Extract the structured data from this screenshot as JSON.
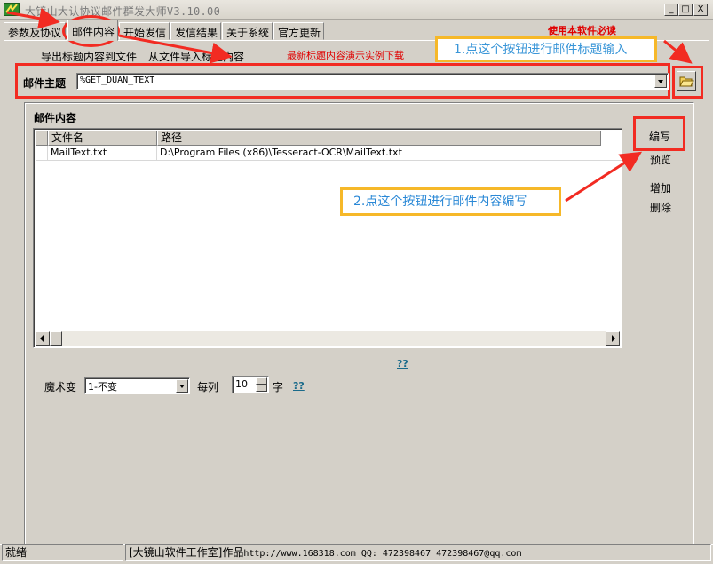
{
  "window": {
    "title": "大镜山大认协议邮件群发大师V3.10.00",
    "minimize": "_",
    "maximize": "□",
    "close": "X"
  },
  "tabs": [
    {
      "label": "参数及协议"
    },
    {
      "label": "邮件内容"
    },
    {
      "label": "开始发信"
    },
    {
      "label": "发信结果"
    },
    {
      "label": "关于系统"
    },
    {
      "label": "官方更新"
    }
  ],
  "toolbar": {
    "export_label": "导出标题内容到文件",
    "import_label": "从文件导入标题内容",
    "must_read": "使用本软件必读",
    "demo_link": "最新标题内容演示实例下载"
  },
  "annotations": {
    "step1": "1.点这个按钮进行邮件标题输入",
    "step2": "2.点这个按钮进行邮件内容编写"
  },
  "subject": {
    "label": "邮件主题",
    "value": "%GET_DUAN_TEXT"
  },
  "content": {
    "title": "邮件内容",
    "columns": [
      "文件名",
      "路径"
    ],
    "rows": [
      {
        "filename": "MailText.txt",
        "path": "D:\\Program Files (x86)\\Tesseract-OCR\\MailText.txt"
      }
    ],
    "buttons": {
      "edit": "编写",
      "preview": "预览",
      "add": "增加",
      "delete": "删除"
    },
    "help_link": "??"
  },
  "options": {
    "magic_label": "魔术变",
    "magic_value": "1-不变",
    "per_column_label": "每列",
    "per_column_value": "10",
    "unit_label": "字",
    "help_link": "??"
  },
  "status": {
    "state": "就绪",
    "credit": "[大镜山软件工作室]作品",
    "contact": "http://www.168318.com QQ: 472398467 472398467@qq.com"
  },
  "colors": {
    "annotation_red": "#f22b22",
    "callout_border": "#f6b829",
    "callout_text": "#3a96d8",
    "link_red": "#e00000"
  }
}
